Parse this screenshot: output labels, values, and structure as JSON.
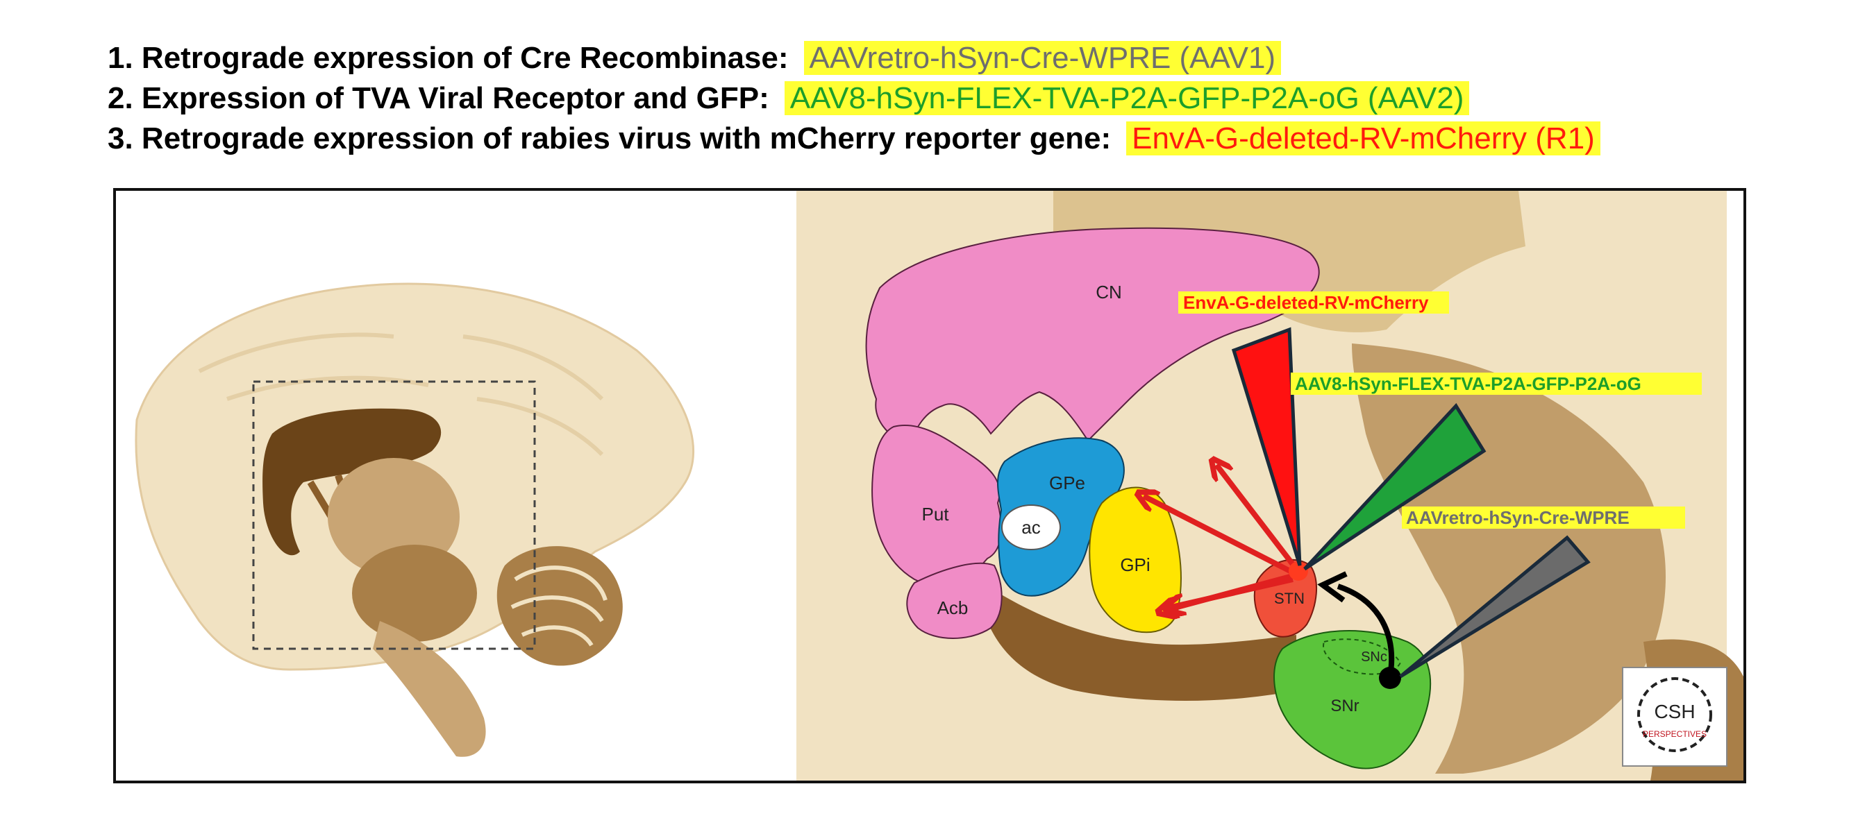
{
  "steps": [
    {
      "label": "1. Retrograde expression of Cre Recombinase:",
      "vector": "AAVretro-hSyn-Cre-WPRE (AAV1)"
    },
    {
      "label": "2. Expression of TVA Viral Receptor and GFP:",
      "vector": "AAV8-hSyn-FLEX-TVA-P2A-GFP-P2A-oG (AAV2)"
    },
    {
      "label": "3. Retrograde expression of rabies virus with mCherry reporter gene:",
      "vector": "EnvA-G-deleted-RV-mCherry (R1)"
    }
  ],
  "colors": {
    "highlight": "#ffff33",
    "aav1_text": "#6e6e6e",
    "aav2_text": "#1c9e2a",
    "rabies_text": "#ff1a0d",
    "tissue_light": "#f1e2c2",
    "tissue_dark": "#6b4418",
    "cn": "#f08cc6",
    "gpe": "#1e9bd6",
    "gpi": "#ffe500",
    "stn": "#f0503a",
    "snr": "#5bc43b",
    "arrow": "#e02020",
    "wedge_red": "#ff1111",
    "wedge_green": "#1fa23a",
    "wedge_gray": "#6b6b6b"
  },
  "regions": {
    "cn": "CN",
    "put": "Put",
    "gpe": "GPe",
    "ac": "ac",
    "gpi": "GPi",
    "acb": "Acb",
    "stn": "STN",
    "snc": "SNc",
    "snr": "SNr"
  },
  "injections": {
    "rabies": "EnvA-G-deleted-RV-mCherry",
    "aav8": "AAV8-hSyn-FLEX-TVA-P2A-GFP-P2A-oG",
    "aavretro": "AAVretro-hSyn-Cre-WPRE"
  },
  "logo": {
    "line1": "CSH",
    "line2": "PERSPECTIVES"
  }
}
